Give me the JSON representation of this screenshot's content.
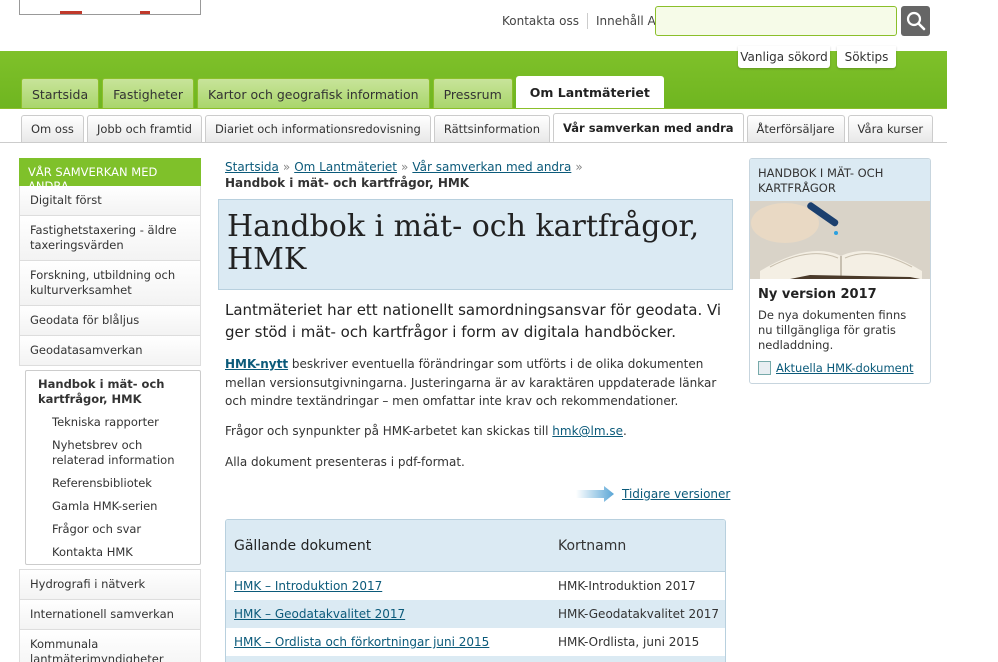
{
  "header": {
    "links": [
      "Kontakta oss",
      "Innehåll A-Ö"
    ],
    "search": {
      "value": "",
      "placeholder": ""
    },
    "quick": [
      "Vanliga sökord",
      "Söktips"
    ]
  },
  "main_nav": {
    "tabs": [
      "Startsida",
      "Fastigheter",
      "Kartor och geografisk information",
      "Pressrum",
      "Om Lantmäteriet"
    ],
    "active": "Om Lantmäteriet"
  },
  "sub_nav": {
    "tabs": [
      "Om oss",
      "Jobb och framtid",
      "Diariet och informationsredovisning",
      "Rättsinformation",
      "Vår samverkan med andra",
      "Återförsäljare",
      "Våra kurser"
    ],
    "active": "Vår samverkan med andra"
  },
  "leftnav": {
    "heading": "VÅR SAMVERKAN MED ANDRA",
    "items_before": [
      "Digitalt först",
      "Fastighetstaxering - äldre taxeringsvärden",
      "Forskning, utbildning och kulturverksamhet",
      "Geodata för blåljus",
      "Geodatasamverkan"
    ],
    "current": "Handbok i mät- och kartfrågor, HMK",
    "children": [
      "Tekniska rapporter",
      "Nyhetsbrev och relaterad information",
      "Referensbibliotek",
      "Gamla HMK-serien",
      "Frågor och svar",
      "Kontakta HMK"
    ],
    "items_after": [
      "Hydrografi i nätverk",
      "Internationell samverkan",
      "Kommunala lantmäterimyndigheter"
    ]
  },
  "breadcrumb": {
    "links": [
      "Startsida",
      "Om Lantmäteriet",
      "Vår samverkan med andra"
    ],
    "current": "Handbok i mät- och kartfrågor, HMK"
  },
  "page": {
    "title": "Handbok i mät- och kartfrågor, HMK",
    "lead": "Lantmäteriet har ett nationellt samordningsansvar för geodata. Vi ger stöd i mät- och kartfrågor i form av digitala handböcker.",
    "p1_link": "HMK-nytt",
    "p1_text": " beskriver eventuella förändringar som utförts i de olika dokumenten mellan versionsutgivningarna. Justeringarna är av karaktären uppdaterade länkar och mindre textändringar – men omfattar inte krav och rekommendationer.",
    "p2_text": "Frågor och synpunkter på HMK-arbetet kan skickas till ",
    "p2_link": "hmk@lm.se",
    "p2_end": ".",
    "p3_text": "Alla dokument presenteras i pdf-format.",
    "prev_versions": "Tidigare versioner"
  },
  "table": {
    "headers": [
      "Gällande dokument",
      "Kortnamn"
    ],
    "rows": [
      [
        "HMK – Introduktion 2017",
        "HMK-Introduktion 2017"
      ],
      [
        "HMK – Geodatakvalitet 2017",
        "HMK-Geodatakvalitet 2017"
      ],
      [
        "HMK – Ordlista och förkortningar juni 2015",
        "HMK-Ordlista, juni 2015"
      ]
    ]
  },
  "sidebox": {
    "heading": "HANDBOK I MÄT- OCH KARTFRÅGOR",
    "title": "Ny version 2017",
    "text": "De nya dokumenten finns nu tillgängliga för gratis nedladdning.",
    "link": "Aktuella HMK-dokument"
  },
  "colors": {
    "green": "#7fc12a",
    "light_blue": "#dbeaf3",
    "link": "#0b5a7a"
  }
}
